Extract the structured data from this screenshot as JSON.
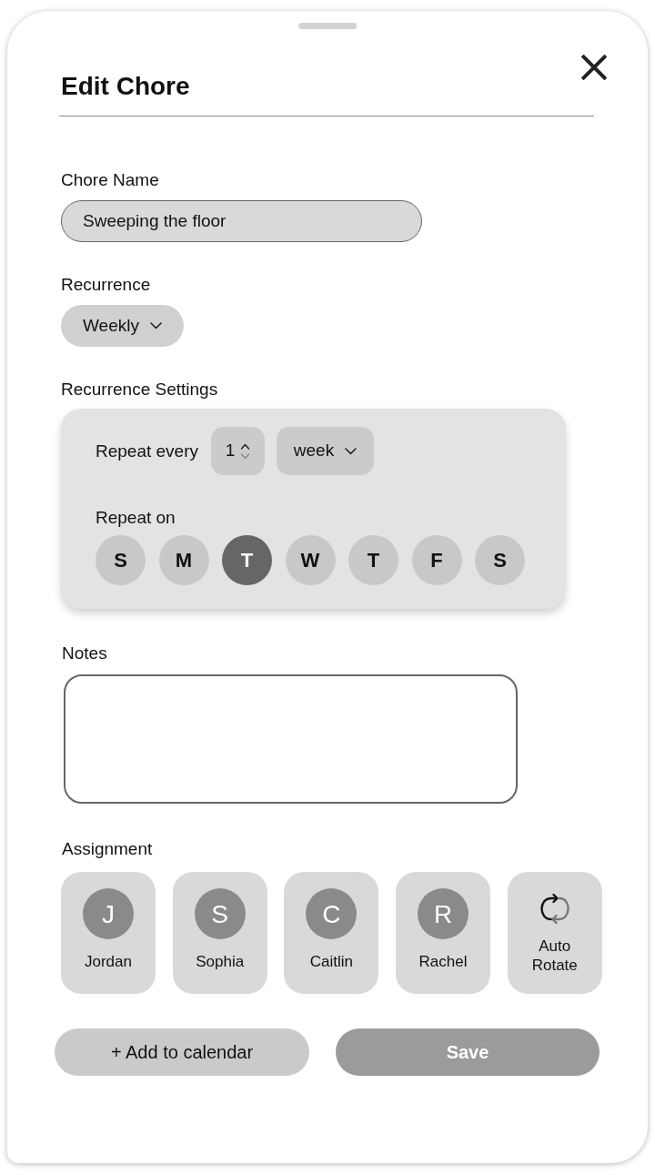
{
  "sheet": {
    "title": "Edit Chore"
  },
  "chore_name": {
    "label": "Chore Name",
    "value": "Sweeping the floor"
  },
  "recurrence": {
    "label": "Recurrence",
    "value": "Weekly"
  },
  "recurrence_settings": {
    "label": "Recurrence Settings",
    "repeat_every": {
      "label": "Repeat every",
      "value": "1",
      "unit": "week"
    },
    "repeat_on": {
      "label": "Repeat on",
      "days": [
        {
          "label": "S",
          "selected": false
        },
        {
          "label": "M",
          "selected": false
        },
        {
          "label": "T",
          "selected": true
        },
        {
          "label": "W",
          "selected": false
        },
        {
          "label": "T",
          "selected": false
        },
        {
          "label": "F",
          "selected": false
        },
        {
          "label": "S",
          "selected": false
        }
      ]
    }
  },
  "notes": {
    "label": "Notes"
  },
  "assignment": {
    "label": "Assignment",
    "options": [
      {
        "kind": "person",
        "initial": "J",
        "name": "Jordan"
      },
      {
        "kind": "person",
        "initial": "S",
        "name": "Sophia"
      },
      {
        "kind": "person",
        "initial": "C",
        "name": "Caitlin"
      },
      {
        "kind": "person",
        "initial": "R",
        "name": "Rachel"
      },
      {
        "kind": "auto",
        "name": "Auto Rotate"
      }
    ]
  },
  "buttons": [
    {
      "kind": "secondary",
      "label": "+ Add to calendar"
    },
    {
      "kind": "primary",
      "label": "Save"
    }
  ]
}
